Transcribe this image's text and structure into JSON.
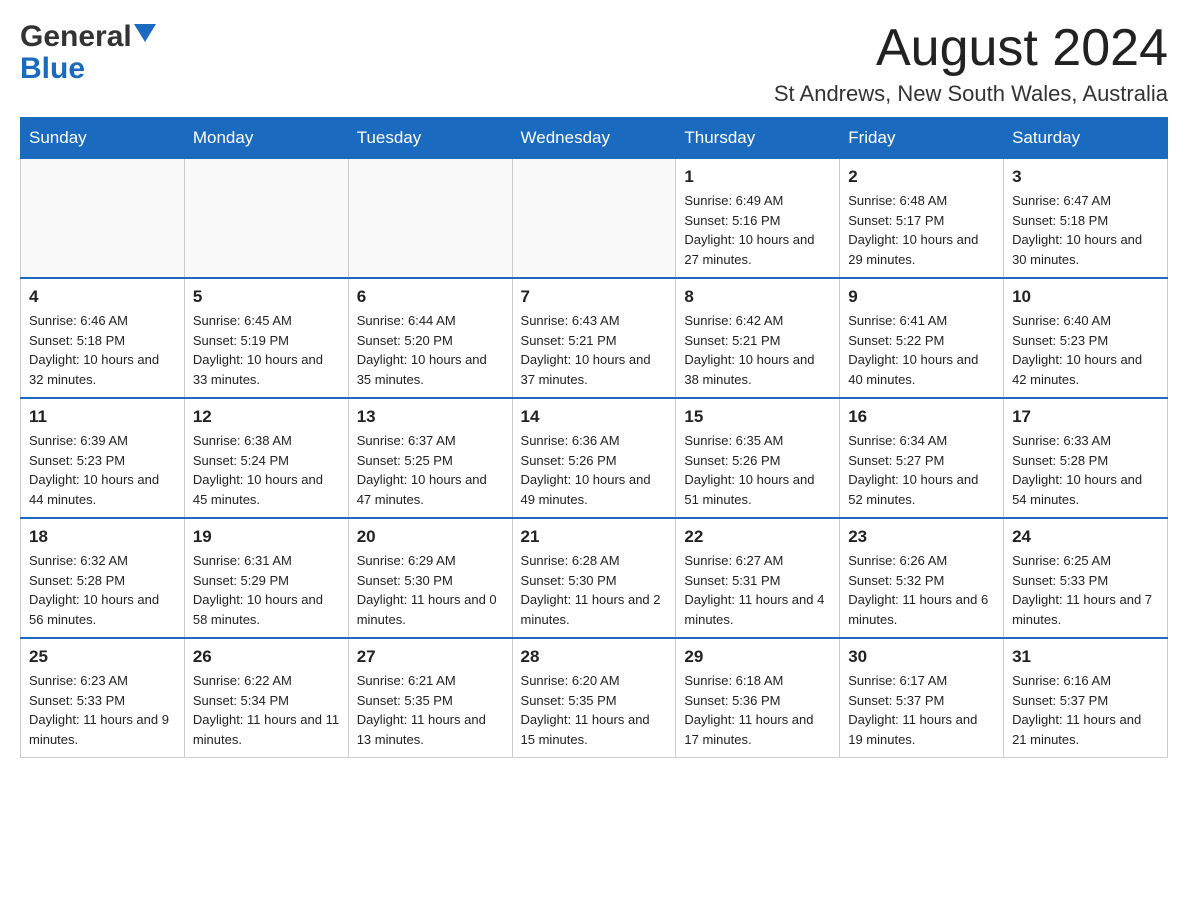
{
  "header": {
    "logo": {
      "general": "General",
      "blue": "Blue"
    },
    "title": "August 2024",
    "location": "St Andrews, New South Wales, Australia"
  },
  "calendar": {
    "days_of_week": [
      "Sunday",
      "Monday",
      "Tuesday",
      "Wednesday",
      "Thursday",
      "Friday",
      "Saturday"
    ],
    "weeks": [
      [
        {
          "day": "",
          "info": ""
        },
        {
          "day": "",
          "info": ""
        },
        {
          "day": "",
          "info": ""
        },
        {
          "day": "",
          "info": ""
        },
        {
          "day": "1",
          "info": "Sunrise: 6:49 AM\nSunset: 5:16 PM\nDaylight: 10 hours and 27 minutes."
        },
        {
          "day": "2",
          "info": "Sunrise: 6:48 AM\nSunset: 5:17 PM\nDaylight: 10 hours and 29 minutes."
        },
        {
          "day": "3",
          "info": "Sunrise: 6:47 AM\nSunset: 5:18 PM\nDaylight: 10 hours and 30 minutes."
        }
      ],
      [
        {
          "day": "4",
          "info": "Sunrise: 6:46 AM\nSunset: 5:18 PM\nDaylight: 10 hours and 32 minutes."
        },
        {
          "day": "5",
          "info": "Sunrise: 6:45 AM\nSunset: 5:19 PM\nDaylight: 10 hours and 33 minutes."
        },
        {
          "day": "6",
          "info": "Sunrise: 6:44 AM\nSunset: 5:20 PM\nDaylight: 10 hours and 35 minutes."
        },
        {
          "day": "7",
          "info": "Sunrise: 6:43 AM\nSunset: 5:21 PM\nDaylight: 10 hours and 37 minutes."
        },
        {
          "day": "8",
          "info": "Sunrise: 6:42 AM\nSunset: 5:21 PM\nDaylight: 10 hours and 38 minutes."
        },
        {
          "day": "9",
          "info": "Sunrise: 6:41 AM\nSunset: 5:22 PM\nDaylight: 10 hours and 40 minutes."
        },
        {
          "day": "10",
          "info": "Sunrise: 6:40 AM\nSunset: 5:23 PM\nDaylight: 10 hours and 42 minutes."
        }
      ],
      [
        {
          "day": "11",
          "info": "Sunrise: 6:39 AM\nSunset: 5:23 PM\nDaylight: 10 hours and 44 minutes."
        },
        {
          "day": "12",
          "info": "Sunrise: 6:38 AM\nSunset: 5:24 PM\nDaylight: 10 hours and 45 minutes."
        },
        {
          "day": "13",
          "info": "Sunrise: 6:37 AM\nSunset: 5:25 PM\nDaylight: 10 hours and 47 minutes."
        },
        {
          "day": "14",
          "info": "Sunrise: 6:36 AM\nSunset: 5:26 PM\nDaylight: 10 hours and 49 minutes."
        },
        {
          "day": "15",
          "info": "Sunrise: 6:35 AM\nSunset: 5:26 PM\nDaylight: 10 hours and 51 minutes."
        },
        {
          "day": "16",
          "info": "Sunrise: 6:34 AM\nSunset: 5:27 PM\nDaylight: 10 hours and 52 minutes."
        },
        {
          "day": "17",
          "info": "Sunrise: 6:33 AM\nSunset: 5:28 PM\nDaylight: 10 hours and 54 minutes."
        }
      ],
      [
        {
          "day": "18",
          "info": "Sunrise: 6:32 AM\nSunset: 5:28 PM\nDaylight: 10 hours and 56 minutes."
        },
        {
          "day": "19",
          "info": "Sunrise: 6:31 AM\nSunset: 5:29 PM\nDaylight: 10 hours and 58 minutes."
        },
        {
          "day": "20",
          "info": "Sunrise: 6:29 AM\nSunset: 5:30 PM\nDaylight: 11 hours and 0 minutes."
        },
        {
          "day": "21",
          "info": "Sunrise: 6:28 AM\nSunset: 5:30 PM\nDaylight: 11 hours and 2 minutes."
        },
        {
          "day": "22",
          "info": "Sunrise: 6:27 AM\nSunset: 5:31 PM\nDaylight: 11 hours and 4 minutes."
        },
        {
          "day": "23",
          "info": "Sunrise: 6:26 AM\nSunset: 5:32 PM\nDaylight: 11 hours and 6 minutes."
        },
        {
          "day": "24",
          "info": "Sunrise: 6:25 AM\nSunset: 5:33 PM\nDaylight: 11 hours and 7 minutes."
        }
      ],
      [
        {
          "day": "25",
          "info": "Sunrise: 6:23 AM\nSunset: 5:33 PM\nDaylight: 11 hours and 9 minutes."
        },
        {
          "day": "26",
          "info": "Sunrise: 6:22 AM\nSunset: 5:34 PM\nDaylight: 11 hours and 11 minutes."
        },
        {
          "day": "27",
          "info": "Sunrise: 6:21 AM\nSunset: 5:35 PM\nDaylight: 11 hours and 13 minutes."
        },
        {
          "day": "28",
          "info": "Sunrise: 6:20 AM\nSunset: 5:35 PM\nDaylight: 11 hours and 15 minutes."
        },
        {
          "day": "29",
          "info": "Sunrise: 6:18 AM\nSunset: 5:36 PM\nDaylight: 11 hours and 17 minutes."
        },
        {
          "day": "30",
          "info": "Sunrise: 6:17 AM\nSunset: 5:37 PM\nDaylight: 11 hours and 19 minutes."
        },
        {
          "day": "31",
          "info": "Sunrise: 6:16 AM\nSunset: 5:37 PM\nDaylight: 11 hours and 21 minutes."
        }
      ]
    ]
  }
}
